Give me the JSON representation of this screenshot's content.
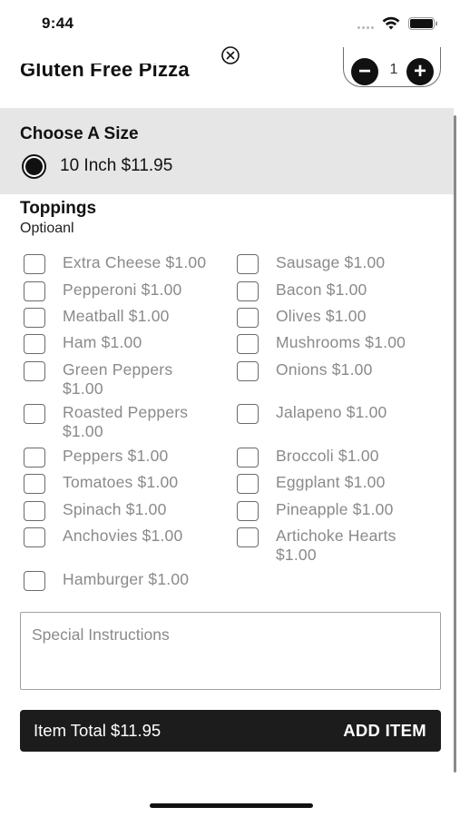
{
  "status_bar": {
    "time": "9:44"
  },
  "header": {
    "item_name": "Gluten Free Pizza",
    "quantity": "1",
    "minus_label": "−",
    "plus_label": "+"
  },
  "size_section": {
    "heading": "Choose A Size",
    "options": [
      {
        "label": "10 Inch $11.95",
        "selected": true
      }
    ]
  },
  "toppings": {
    "heading": "Toppings",
    "subtitle": "Optioanl",
    "left": [
      {
        "label": "Extra Cheese $1.00",
        "checked": false
      },
      {
        "label": "Pepperoni $1.00",
        "checked": false
      },
      {
        "label": "Meatball $1.00",
        "checked": false
      },
      {
        "label": "Ham $1.00",
        "checked": false
      },
      {
        "label": "Green Peppers $1.00",
        "checked": false
      },
      {
        "label": "Roasted Peppers $1.00",
        "checked": false
      },
      {
        "label": "Peppers $1.00",
        "checked": false
      },
      {
        "label": "Tomatoes $1.00",
        "checked": false
      },
      {
        "label": "Spinach $1.00",
        "checked": false
      },
      {
        "label": "Anchovies $1.00",
        "checked": false
      },
      {
        "label": "Hamburger $1.00",
        "checked": false
      }
    ],
    "right": [
      {
        "label": "Sausage $1.00",
        "checked": false
      },
      {
        "label": "Bacon $1.00",
        "checked": false
      },
      {
        "label": "Olives $1.00",
        "checked": false
      },
      {
        "label": "Mushrooms $1.00",
        "checked": false
      },
      {
        "label": "Onions $1.00",
        "checked": false
      },
      {
        "label": "Jalapeno $1.00",
        "checked": false
      },
      {
        "label": "Broccoli $1.00",
        "checked": false
      },
      {
        "label": "Eggplant $1.00",
        "checked": false
      },
      {
        "label": "Pineapple $1.00",
        "checked": false
      },
      {
        "label": "Artichoke Hearts $1.00",
        "checked": false
      }
    ]
  },
  "instructions": {
    "placeholder": "Special Instructions",
    "value": ""
  },
  "footer": {
    "total_label": "Item Total $11.95",
    "add_button": "ADD ITEM"
  },
  "icons": {
    "close": "close-circle-icon",
    "wifi": "wifi-icon",
    "battery": "battery-icon",
    "minus": "minus-circle-icon",
    "plus": "plus-circle-icon"
  },
  "colors": {
    "size_section_bg": "#e6e6e6",
    "add_bar_bg": "#1c1c1c",
    "topping_text": "#8a8a8a"
  }
}
